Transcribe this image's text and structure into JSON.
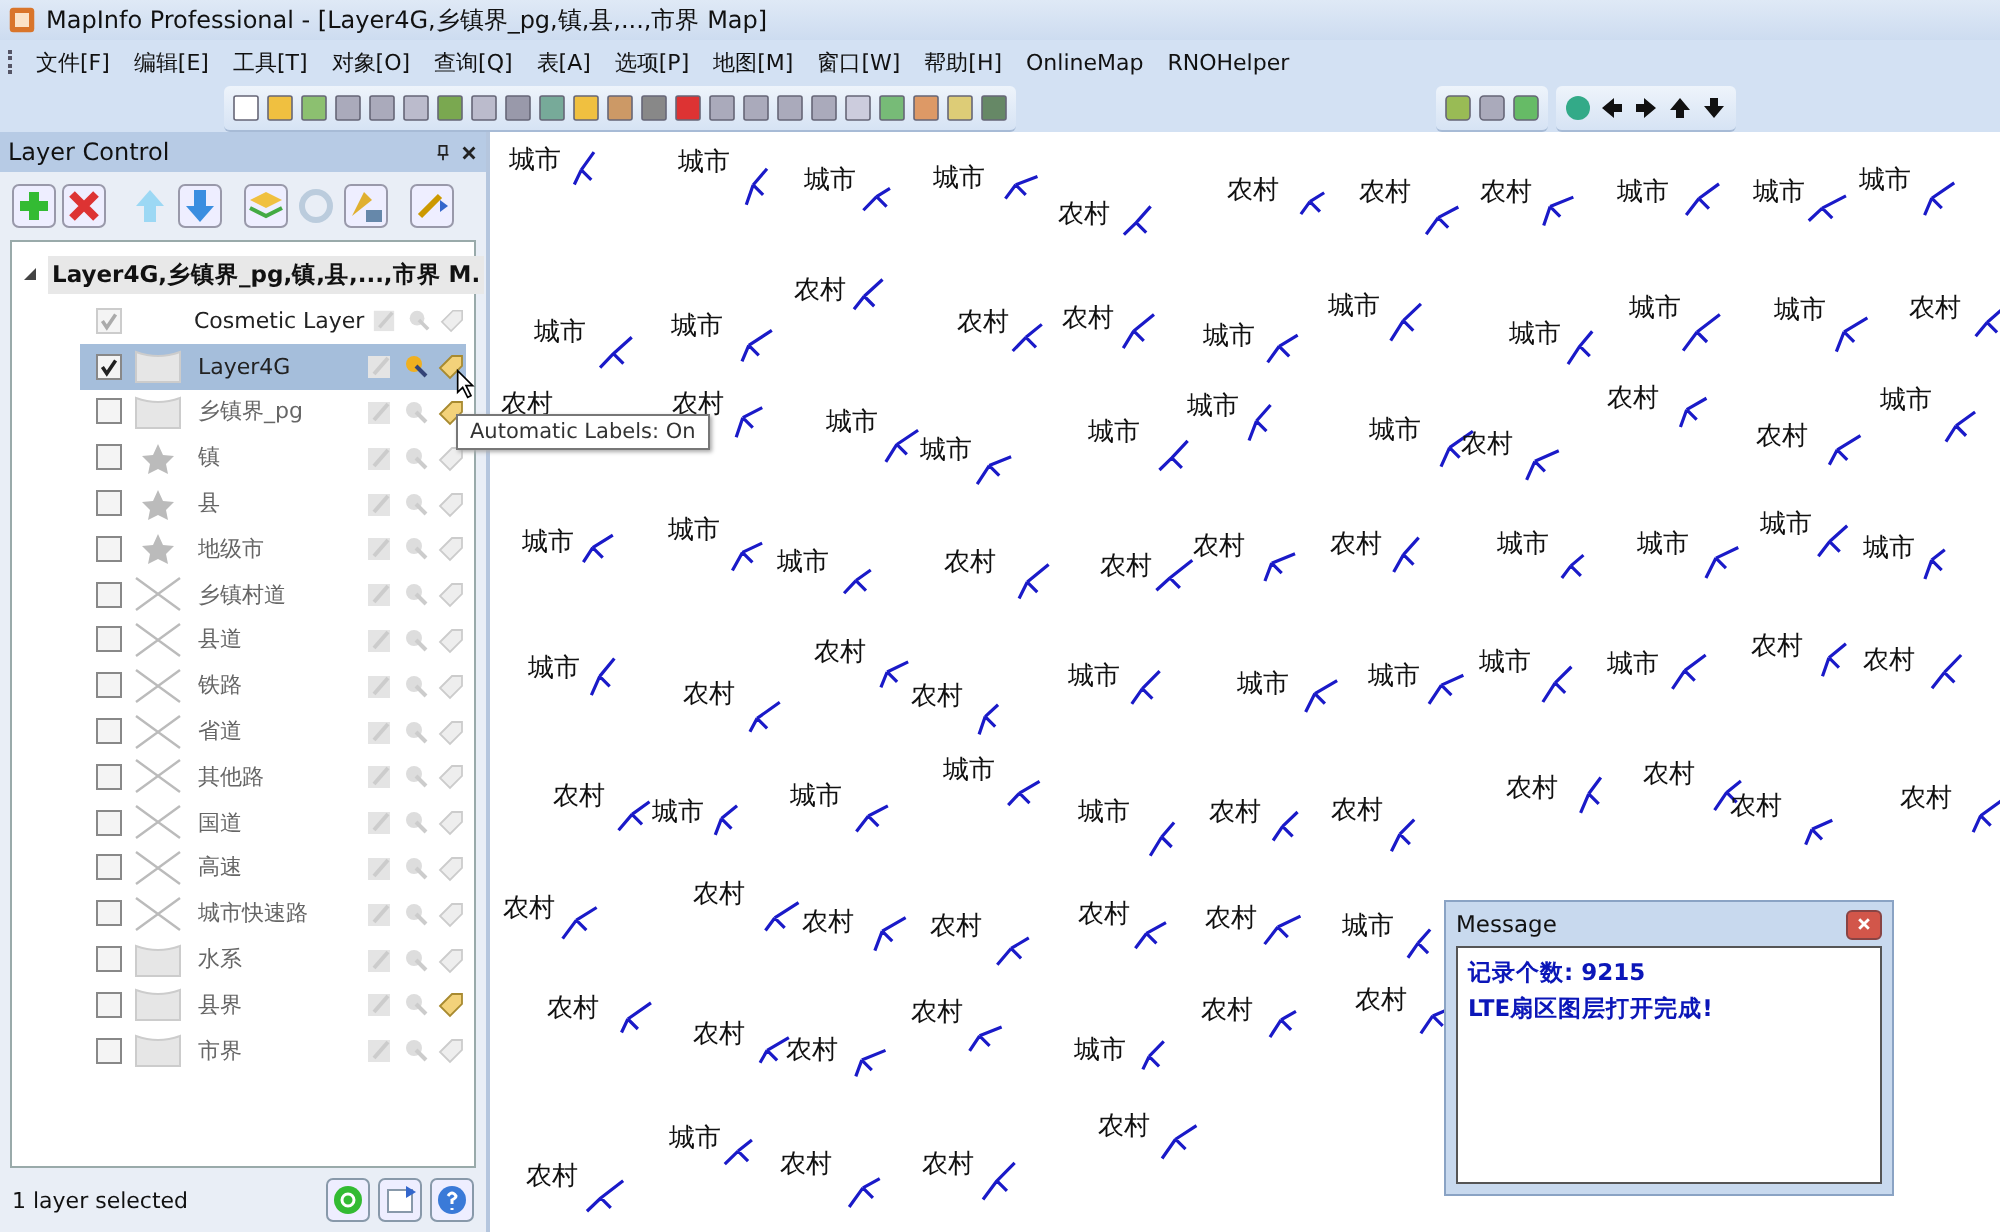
{
  "window": {
    "title": "MapInfo Professional - [Layer4G,乡镇界_pg,镇,县,...,市界 Map]"
  },
  "menu": [
    "文件[F]",
    "编辑[E]",
    "工具[T]",
    "对象[O]",
    "查询[Q]",
    "表[A]",
    "选项[P]",
    "地图[M]",
    "窗口[W]",
    "帮助[H]",
    "OnlineMap",
    "RNOHelper"
  ],
  "layer_control": {
    "title": "Layer Control",
    "map_name": "Layer4G,乡镇界_pg,镇,县,...,市界 M.",
    "expanded": true,
    "layers": [
      {
        "name": "Cosmetic Layer",
        "kind": "cosmetic",
        "checked": true,
        "selected": false,
        "selectable": false,
        "labels_on": false
      },
      {
        "name": "Layer4G",
        "kind": "region",
        "checked": true,
        "selected": true,
        "selectable": true,
        "labels_on": true
      },
      {
        "name": "乡镇界_pg",
        "kind": "region",
        "checked": false,
        "selected": false,
        "selectable": false,
        "labels_on": true
      },
      {
        "name": "镇",
        "kind": "point",
        "checked": false,
        "selected": false,
        "selectable": false,
        "labels_on": false
      },
      {
        "name": "县",
        "kind": "point",
        "checked": false,
        "selected": false,
        "selectable": false,
        "labels_on": false
      },
      {
        "name": "地级市",
        "kind": "point",
        "checked": false,
        "selected": false,
        "selectable": false,
        "labels_on": false
      },
      {
        "name": "乡镇村道",
        "kind": "line",
        "checked": false,
        "selected": false,
        "selectable": false,
        "labels_on": false
      },
      {
        "name": "县道",
        "kind": "line",
        "checked": false,
        "selected": false,
        "selectable": false,
        "labels_on": false
      },
      {
        "name": "铁路",
        "kind": "line",
        "checked": false,
        "selected": false,
        "selectable": false,
        "labels_on": false
      },
      {
        "name": "省道",
        "kind": "line",
        "checked": false,
        "selected": false,
        "selectable": false,
        "labels_on": false
      },
      {
        "name": "其他路",
        "kind": "line",
        "checked": false,
        "selected": false,
        "selectable": false,
        "labels_on": false
      },
      {
        "name": "国道",
        "kind": "line",
        "checked": false,
        "selected": false,
        "selectable": false,
        "labels_on": false
      },
      {
        "name": "高速",
        "kind": "line",
        "checked": false,
        "selected": false,
        "selectable": false,
        "labels_on": false
      },
      {
        "name": "城市快速路",
        "kind": "line",
        "checked": false,
        "selected": false,
        "selectable": false,
        "labels_on": false
      },
      {
        "name": "水系",
        "kind": "region",
        "checked": false,
        "selected": false,
        "selectable": false,
        "labels_on": false
      },
      {
        "name": "县界",
        "kind": "region",
        "checked": false,
        "selected": false,
        "selectable": false,
        "labels_on": true
      },
      {
        "name": "市界",
        "kind": "region",
        "checked": false,
        "selected": false,
        "selectable": false,
        "labels_on": false
      }
    ],
    "tooltip": "Automatic Labels: On",
    "status": "1 layer selected"
  },
  "map": {
    "labels": [
      "城市",
      "城市",
      "城市",
      "城市",
      "农村",
      "农村",
      "农村",
      "农村",
      "城市",
      "城市",
      "城市",
      "城市",
      "城市",
      "农村",
      "农村",
      "农村",
      "城市",
      "城市",
      "城市",
      "城市",
      "城市",
      "农村",
      "农村",
      "农村",
      "城市",
      "城市",
      "城市",
      "城市",
      "城市",
      "农村",
      "农村",
      "农村",
      "城市",
      "城市",
      "城市",
      "城市",
      "农村",
      "农村",
      "农村",
      "农村",
      "城市",
      "城市",
      "城市",
      "城市",
      "城市",
      "农村",
      "农村",
      "农村",
      "城市",
      "城市",
      "城市",
      "城市",
      "城市",
      "农村",
      "农村",
      "农村",
      "城市",
      "城市",
      "城市",
      "城市",
      "农村",
      "农村",
      "农村",
      "农村",
      "农村",
      "农村",
      "农村",
      "农村",
      "农村",
      "农村",
      "农村",
      "农村",
      "城市",
      "农村",
      "农村",
      "农村",
      "农村",
      "城市",
      "农村",
      "农村",
      "农村",
      "城市",
      "农村",
      "农村",
      "农村"
    ]
  },
  "message": {
    "title": "Message",
    "lines": [
      "记录个数: 9215",
      "LTE扇区图层打开完成!"
    ]
  }
}
